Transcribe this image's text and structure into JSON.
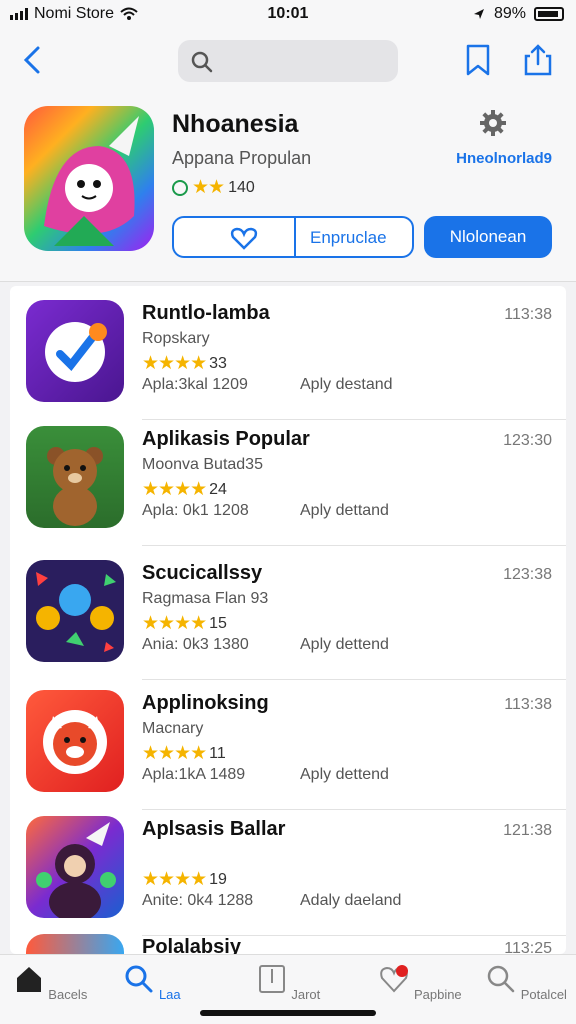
{
  "status_bar": {
    "carrier": "Nomi Store",
    "time": "10:01",
    "battery": "89%"
  },
  "nav": {
    "back_icon": "chevron-left-icon",
    "search_icon": "search-icon",
    "bookmark_icon": "bookmark-icon",
    "share_icon": "share-icon"
  },
  "header": {
    "title": "Nhoanesia",
    "subtitle": "Appana Propulan",
    "rating_value": "140",
    "link": "Hneolnorlad9",
    "outline_button": "Enpruclae",
    "primary_button": "Nlolonean",
    "accent": "#1a73e8"
  },
  "apps": [
    {
      "name": "Runtlo-lamba",
      "dev": "Ropskary",
      "rating": "33",
      "meta": "Apla:3kal  1209",
      "status": "Aply destand",
      "time": "113:38"
    },
    {
      "name": "Aplikasis Popular",
      "dev": "Moonva Butad35",
      "rating": "24",
      "meta": "Apla: 0k1  1208",
      "status": "Aply dettand",
      "time": "123:30"
    },
    {
      "name": "Scucicallssy",
      "dev": "Ragmasa Flan 93",
      "rating": "15",
      "meta": "Ania: 0k3  1380",
      "status": "Aply dettend",
      "time": "123:38"
    },
    {
      "name": "Applinoksing",
      "dev": "Macnary",
      "rating": "11",
      "meta": "Apla:1kA  1489",
      "status": "Aply dettend",
      "time": "113:38"
    },
    {
      "name": "Aplsasis Ballar",
      "dev": "",
      "rating": "19",
      "meta": "Anite: 0k4  1288",
      "status": "Adaly daeland",
      "time": "121:38"
    },
    {
      "name": "Polalabsiy",
      "dev": "",
      "rating": "",
      "meta": "",
      "status": "",
      "time": "113:25"
    }
  ],
  "tabs": [
    {
      "label": "Bacels",
      "icon": "home-icon"
    },
    {
      "label": "Laa",
      "icon": "search-icon"
    },
    {
      "label": "Jarot",
      "icon": "book-icon"
    },
    {
      "label": "Papbine",
      "icon": "heart-icon"
    },
    {
      "label": "Potalcel",
      "icon": "search-icon"
    }
  ]
}
